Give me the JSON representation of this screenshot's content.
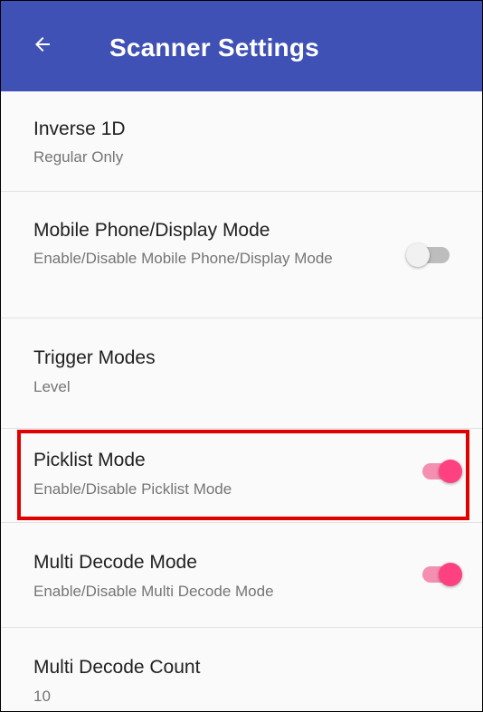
{
  "appbar": {
    "title": "Scanner Settings",
    "back_icon": "arrow-left-icon",
    "color": "#3f51b5"
  },
  "settings": [
    {
      "title": "Inverse 1D",
      "subtitle": "Regular Only"
    },
    {
      "title": "Mobile Phone/Display Mode",
      "subtitle": "Enable/Disable Mobile Phone/Display Mode",
      "toggle": false
    },
    {
      "title": "Trigger Modes",
      "subtitle": "Level"
    },
    {
      "title": "Picklist Mode",
      "subtitle": "Enable/Disable Picklist Mode",
      "toggle": true,
      "highlighted": true
    },
    {
      "title": "Multi Decode Mode",
      "subtitle": "Enable/Disable Multi Decode Mode",
      "toggle": true
    },
    {
      "title": "Multi Decode Count",
      "subtitle": "10"
    }
  ],
  "colors": {
    "toggle_on": "#ff4081",
    "toggle_off": "#bdbdbd",
    "highlight_border": "#e00000"
  }
}
